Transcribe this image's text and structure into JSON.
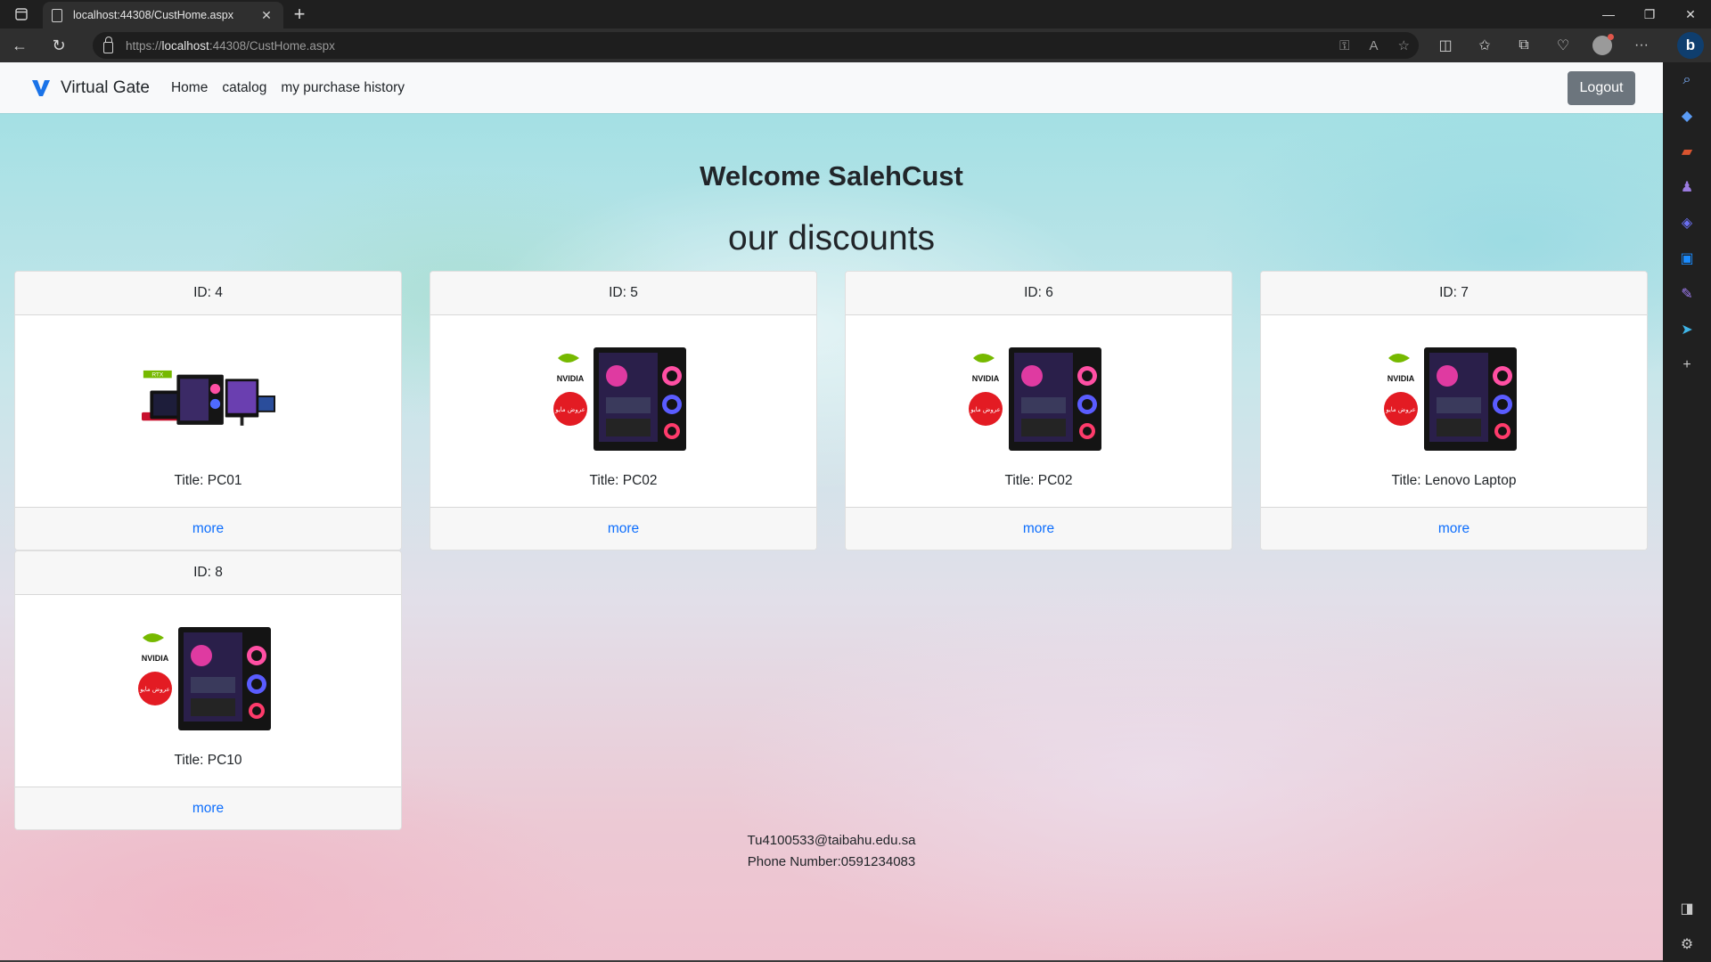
{
  "browser": {
    "tab_title": "localhost:44308/CustHome.aspx",
    "url_scheme": "https://",
    "url_host": "localhost",
    "url_rest": ":44308/CustHome.aspx"
  },
  "navbar": {
    "brand": "Virtual Gate",
    "links": [
      "Home",
      "catalog",
      "my purchase history"
    ],
    "logout_label": "Logout"
  },
  "main": {
    "welcome": "Welcome SalehCust",
    "section_title": "our discounts",
    "cards": [
      {
        "id_label": "ID: 4",
        "title": "Title: PC01",
        "more": "more",
        "image": "pc-bundle-with-monitor"
      },
      {
        "id_label": "ID: 5",
        "title": "Title: PC02",
        "more": "more",
        "image": "gaming-pc-nvidia-offer"
      },
      {
        "id_label": "ID: 6",
        "title": "Title: PC02",
        "more": "more",
        "image": "gaming-pc-nvidia-offer"
      },
      {
        "id_label": "ID: 7",
        "title": "Title: Lenovo Laptop",
        "more": "more",
        "image": "gaming-pc-nvidia-offer"
      },
      {
        "id_label": "ID: 8",
        "title": "Title: PC10",
        "more": "more",
        "image": "gaming-pc-nvidia-offer"
      }
    ]
  },
  "footer": {
    "email": "Tu4100533@taibahu.edu.sa",
    "phone": "Phone Number:0591234083"
  },
  "product_badges": {
    "nvidia": "NVIDIA",
    "offer": "عروض مايو",
    "rtx": "RTX"
  },
  "colors": {
    "link": "#0d6efd",
    "logout_bg": "#6c757d",
    "brand_logo": "#1a73e8"
  }
}
